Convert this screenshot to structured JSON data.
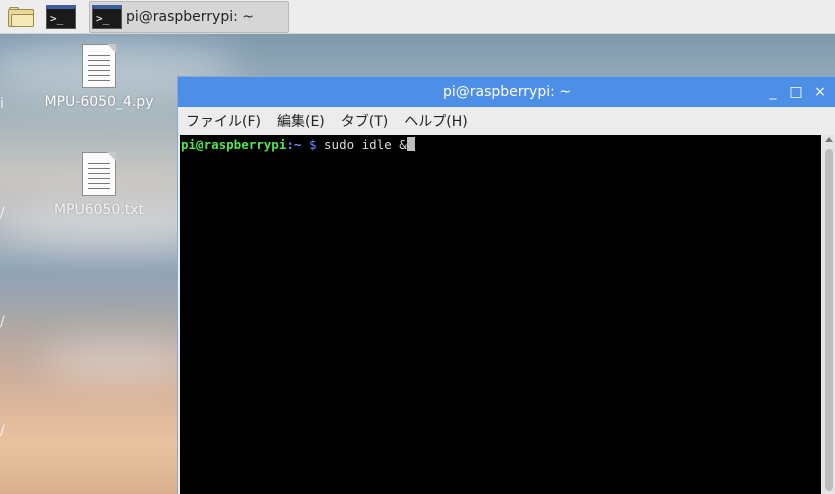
{
  "taskbar": {
    "file_manager_icon": "folder-icon",
    "terminal_icon_text": ">_",
    "task_label": "pi@raspberrypi: ~"
  },
  "desktop": {
    "icons": [
      {
        "label": "MPU-6050_4.py",
        "icon": "text-file-icon"
      },
      {
        "label": "MPU6050.txt",
        "icon": "text-file-icon"
      }
    ],
    "edge_marks": [
      "i",
      "/",
      "/",
      "/"
    ]
  },
  "window": {
    "title": "pi@raspberrypi: ~",
    "controls": {
      "minimize": "_",
      "maximize": "□",
      "close": "×"
    },
    "menu": [
      "ファイル(F)",
      "編集(E)",
      "タブ(T)",
      "ヘルプ(H)"
    ],
    "terminal": {
      "user_host": "pi@raspberrypi",
      "path": ":~",
      "dollar": "$",
      "command": "sudo idle &"
    }
  },
  "colors": {
    "titlebar": "#4d8fe6",
    "prompt_user": "#55e255",
    "prompt_path": "#6a8cff"
  }
}
